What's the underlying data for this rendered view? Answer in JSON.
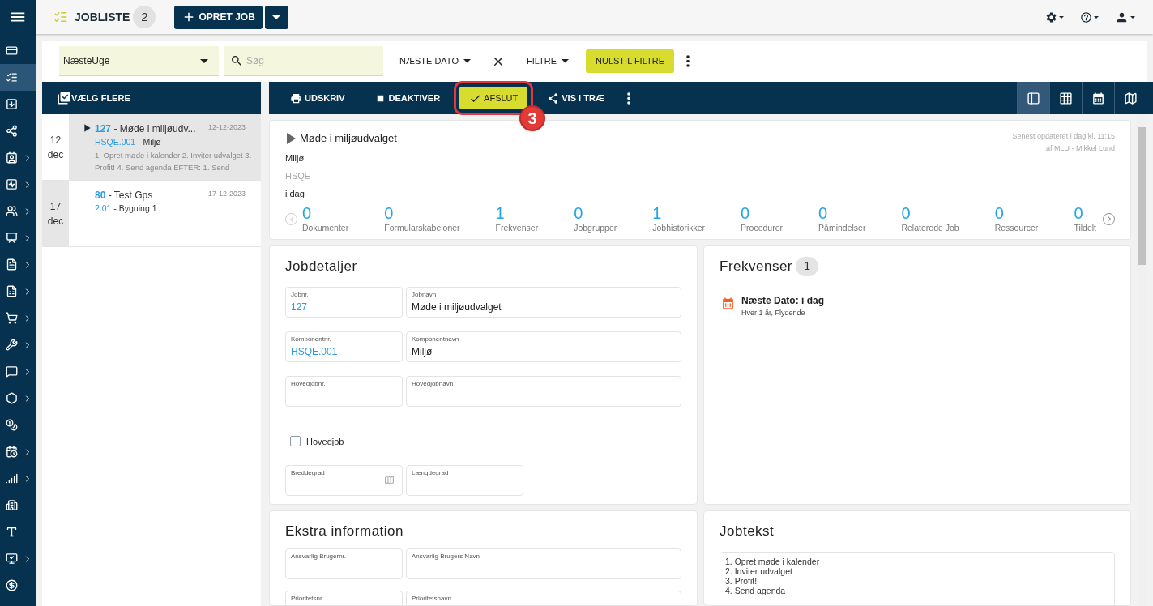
{
  "sidebar": {
    "items": [
      {
        "selected": false,
        "expandable": false
      },
      {
        "selected": true,
        "expandable": false
      },
      {
        "selected": false,
        "expandable": false
      },
      {
        "selected": false,
        "expandable": false
      },
      {
        "selected": false,
        "expandable": true
      },
      {
        "selected": false,
        "expandable": true
      },
      {
        "selected": false,
        "expandable": true
      },
      {
        "selected": false,
        "expandable": true
      },
      {
        "selected": false,
        "expandable": true
      },
      {
        "selected": false,
        "expandable": true
      },
      {
        "selected": false,
        "expandable": true
      },
      {
        "selected": false,
        "expandable": true
      },
      {
        "selected": false,
        "expandable": true
      },
      {
        "selected": false,
        "expandable": true
      },
      {
        "selected": false,
        "expandable": false
      },
      {
        "selected": false,
        "expandable": true
      },
      {
        "selected": false,
        "expandable": true
      },
      {
        "selected": false,
        "expandable": false
      },
      {
        "selected": false,
        "expandable": false
      },
      {
        "selected": false,
        "expandable": true
      },
      {
        "selected": false,
        "expandable": false
      }
    ]
  },
  "header": {
    "title": "JOBLISTE",
    "count": "2",
    "create_button": "OPRET JOB"
  },
  "filters": {
    "period": "NæsteUge",
    "search": {
      "placeholder": "Søg"
    },
    "sort": "NÆSTE DATO",
    "filter_menu": "FILTRE",
    "reset_button": "NULSTIL FILTRE"
  },
  "list": {
    "select_button": "VÆLG FLERE",
    "jobs": [
      {
        "day": "12",
        "month": "dec",
        "number": "127",
        "title": "Møde i miljøudv...",
        "date": "12-12-2023",
        "component_number": "HSQE.001",
        "component_name": "Miljø",
        "separator": "-",
        "description": "1. Opret møde i kalender 2. Inviter udvalget 3. Profit! 4. Send agenda EFTER: 1. Send",
        "selected": true
      },
      {
        "day": "17",
        "month": "dec",
        "number": "80",
        "title": "Test Gps",
        "date": "17-12-2023",
        "component_number": "2.01",
        "component_name": "Bygning 1",
        "separator": "-",
        "selected": false
      }
    ]
  },
  "toolbar": {
    "actions": [
      {
        "label": "UDSKRIV",
        "highlighted": false
      },
      {
        "label": "DEAKTIVER",
        "highlighted": false
      },
      {
        "label": "AFSLUT",
        "highlighted": true,
        "callout": "3"
      },
      {
        "label": "VIS I TRÆ",
        "highlighted": false
      }
    ],
    "views": [
      {
        "selected": true
      },
      {
        "selected": false
      },
      {
        "selected": false
      },
      {
        "selected": false
      }
    ]
  },
  "detail": {
    "title": "Møde i miljøudvalget",
    "component": "Miljø",
    "category": "HSQE",
    "due": "i dag",
    "updated": "Senest opdateret i dag kl. 11:15",
    "updated_by": "af MLU - Mikkel Lund",
    "stats": [
      {
        "count": "0",
        "label": "Dokumenter"
      },
      {
        "count": "0",
        "label": "Formularskabeloner"
      },
      {
        "count": "1",
        "label": "Frekvenser"
      },
      {
        "count": "0",
        "label": "Jobgrupper"
      },
      {
        "count": "1",
        "label": "Jobhistorikker"
      },
      {
        "count": "0",
        "label": "Procedurer"
      },
      {
        "count": "0",
        "label": "Påmindelser"
      },
      {
        "count": "0",
        "label": "Relaterede Job"
      },
      {
        "count": "0",
        "label": "Ressourcer"
      },
      {
        "count": "0",
        "label": "Tildelt"
      }
    ]
  },
  "job_details": {
    "title": "Jobdetaljer",
    "fields": [
      {
        "label": "Jobnr.",
        "value": "127",
        "kind": "link"
      },
      {
        "label": "Jobnavn",
        "value": "Møde i miljøudvalget",
        "kind": "text"
      },
      {
        "label": "Komponentnr.",
        "value": "HSQE.001",
        "kind": "link"
      },
      {
        "label": "Komponentnavn",
        "value": "Miljø",
        "kind": "text"
      },
      {
        "label": "Hovedjobnr."
      },
      {
        "label": "Hovedjobnavn"
      }
    ],
    "checkbox": {
      "label": "Hovedjob",
      "checked": false
    },
    "coordinates": [
      {
        "label": "Breddegrad",
        "map": true
      },
      {
        "label": "Længdegrad",
        "map": false
      }
    ]
  },
  "frequencies": {
    "title": "Frekvenser",
    "count": "1",
    "items": [
      {
        "title": "Næste Dato: i dag",
        "detail": "Hver 1 år, Flydende"
      }
    ]
  },
  "extra": {
    "title": "Ekstra information",
    "fields": [
      {
        "label": "Ansvarlig Brugernr."
      },
      {
        "label": "Ansvarlig Brugers Navn"
      },
      {
        "label": "Prioritetsnr."
      },
      {
        "label": "Prioritetsnavn"
      }
    ]
  },
  "job_text": {
    "title": "Jobtekst",
    "lines": [
      "1. Opret møde i kalender",
      "2. Inviter udvalget",
      "3. Profit!",
      "4. Send agenda"
    ]
  }
}
